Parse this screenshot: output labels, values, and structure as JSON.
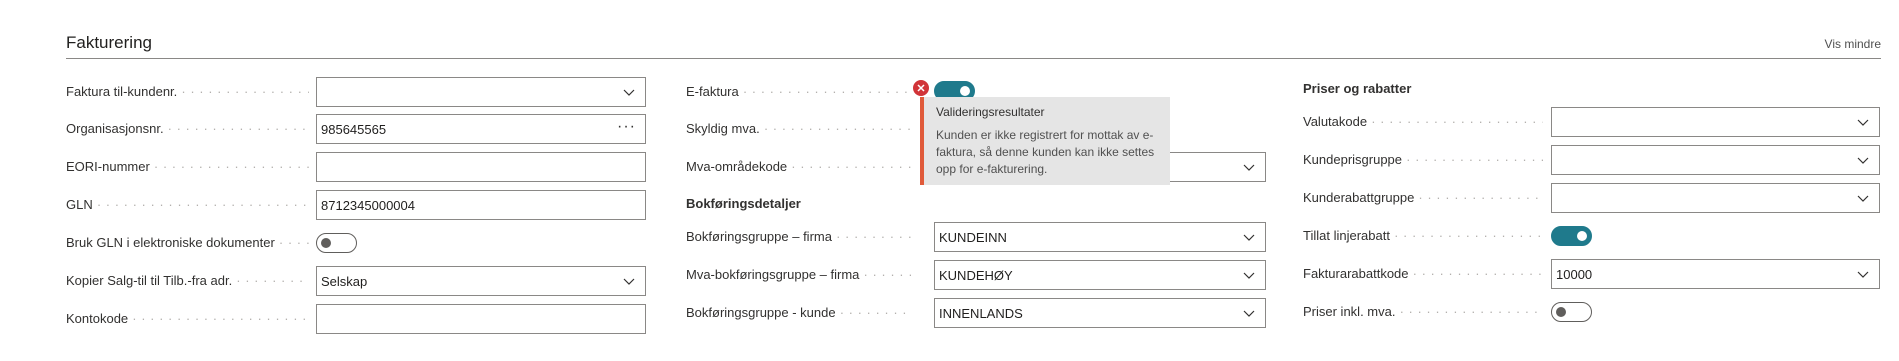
{
  "header": {
    "title": "Fakturering",
    "toggle_label": "Vis mindre"
  },
  "col1": {
    "faktura_til": {
      "label": "Faktura til-kundenr.",
      "value": ""
    },
    "org_nr": {
      "label": "Organisasjonsnr.",
      "value": "985645565"
    },
    "eori": {
      "label": "EORI-nummer",
      "value": ""
    },
    "gln": {
      "label": "GLN",
      "value": "8712345000004"
    },
    "bruk_gln": {
      "label": "Bruk GLN i elektroniske dokumenter",
      "on": false
    },
    "kopier": {
      "label": "Kopier Salg-til til Tilb.-fra adr.",
      "value": "Selskap"
    },
    "kontokode": {
      "label": "Kontokode",
      "value": ""
    }
  },
  "col2": {
    "efaktura": {
      "label": "E-faktura",
      "on": true
    },
    "skyldig_mva": {
      "label": "Skyldig mva."
    },
    "mva_omrade": {
      "label": "Mva-områdekode",
      "value": ""
    },
    "bokforing_title": "Bokføringsdetaljer",
    "bokf_firma": {
      "label": "Bokføringsgruppe – firma",
      "value": "KUNDEINN"
    },
    "mva_bokf_firma": {
      "label": "Mva-bokføringsgruppe – firma",
      "value": "KUNDEHØY"
    },
    "bokf_kunde": {
      "label": "Bokføringsgruppe - kunde",
      "value": "INNENLANDS"
    }
  },
  "col3": {
    "section_title": "Priser og rabatter",
    "valutakode": {
      "label": "Valutakode",
      "value": ""
    },
    "kundeprisgruppe": {
      "label": "Kundeprisgruppe",
      "value": ""
    },
    "kunderabattgruppe": {
      "label": "Kunderabattgruppe",
      "value": ""
    },
    "tillat_linjerabatt": {
      "label": "Tillat linjerabatt",
      "on": true
    },
    "fakturarabattkode": {
      "label": "Fakturarabattkode",
      "value": "10000"
    },
    "priser_inkl_mva": {
      "label": "Priser inkl. mva.",
      "on": false
    }
  },
  "tooltip": {
    "title": "Valideringsresultater",
    "body": "Kunden er ikke registrert for mottak av e-faktura, så denne kunden kan ikke settes opp for e-fakturering."
  },
  "colors": {
    "accent": "#1f7a8c",
    "error": "#d13438",
    "tooltip_border": "#e05a3a"
  }
}
